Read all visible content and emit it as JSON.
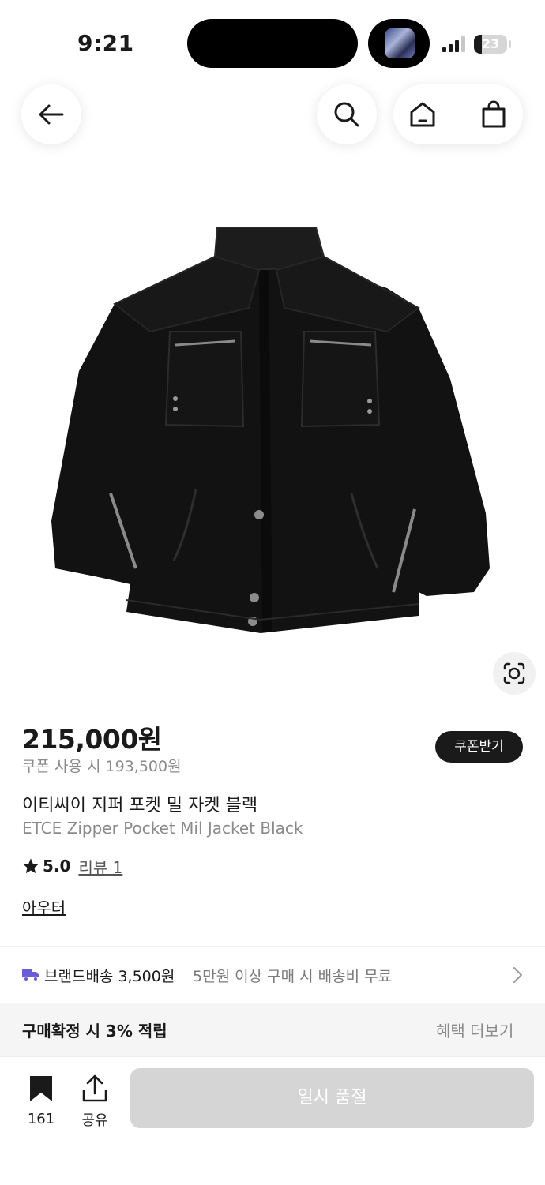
{
  "status_bar": {
    "time": "9:21",
    "battery": "23",
    "battery_level": 0.23
  },
  "nav": {
    "back_icon": "arrow-left-icon",
    "search_icon": "search-icon",
    "home_icon": "home-icon",
    "cart_icon": "shopping-bag-icon"
  },
  "product": {
    "image_alt_icon": "black-zipper-jacket",
    "price": "215,000원",
    "coupon_price": "쿠폰 사용 시 193,500원",
    "coupon_button": "쿠폰받기",
    "name_ko": "이티씨이 지퍼 포켓 밀 자켓 블랙",
    "name_en": "ETCE Zipper Pocket Mil Jacket Black",
    "rating": "5.0",
    "review_link": "리뷰 1",
    "category": "아우터"
  },
  "shipping": {
    "label": "브랜드배송 3,500원",
    "note": "5만원 이상 구매 시 배송비 무료",
    "icon": "truck-icon"
  },
  "points": {
    "label": "구매확정 시 3% 적립",
    "link": "혜택 더보기"
  },
  "bottom_bar": {
    "bookmark_count": "161",
    "share_label": "공유",
    "soldout_label": "일시 품절"
  },
  "colors": {
    "accent": "#6b5bd6",
    "primary": "#1a1a1a",
    "muted": "#8a8a8a",
    "disabled": "#d5d5d5"
  }
}
